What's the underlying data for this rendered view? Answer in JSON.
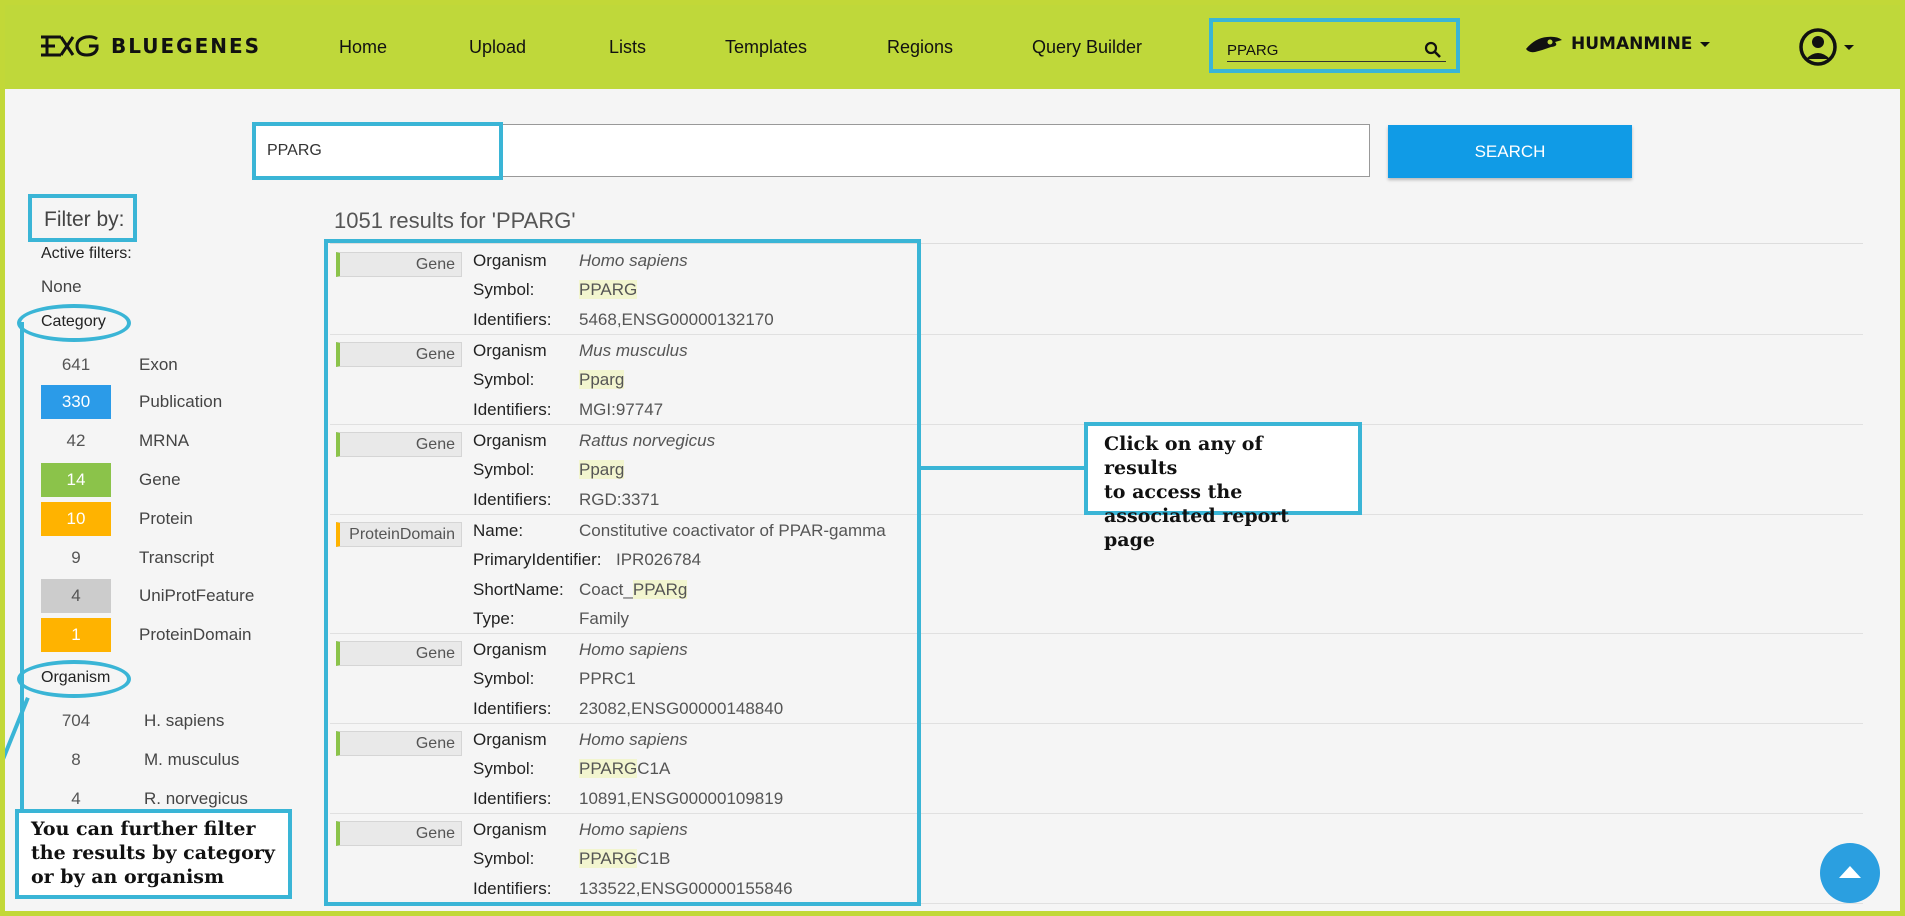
{
  "header": {
    "brand": "BLUEGENES",
    "nav": [
      "Home",
      "Upload",
      "Lists",
      "Templates",
      "Regions",
      "Query Builder"
    ],
    "search_value": "PPARG",
    "mine_name": "HUMANMINE"
  },
  "search": {
    "value": "PPARG",
    "button_label": "SEARCH"
  },
  "filters": {
    "title": "Filter by:",
    "active_label": "Active filters:",
    "active_value": "None",
    "category_label": "Category",
    "categories": [
      {
        "count": "641",
        "label": "Exon",
        "color": ""
      },
      {
        "count": "330",
        "label": "Publication",
        "color": "#2b9be8"
      },
      {
        "count": "42",
        "label": "MRNA",
        "color": ""
      },
      {
        "count": "14",
        "label": "Gene",
        "color": "#8bc34a"
      },
      {
        "count": "10",
        "label": "Protein",
        "color": "#ffb300"
      },
      {
        "count": "9",
        "label": "Transcript",
        "color": ""
      },
      {
        "count": "4",
        "label": "UniProtFeature",
        "color": "#cccccc"
      },
      {
        "count": "1",
        "label": "ProteinDomain",
        "color": "#ffb300"
      }
    ],
    "organism_label": "Organism",
    "organisms": [
      {
        "count": "704",
        "label": "H. sapiens"
      },
      {
        "count": "8",
        "label": "M. musculus"
      },
      {
        "count": "4",
        "label": "R. norvegicus"
      }
    ]
  },
  "results": {
    "summary": "1051 results for 'PPARG'",
    "items": [
      {
        "type": "Gene",
        "rows": [
          {
            "field": "Organism",
            "value": "Homo sapiens",
            "italic": true
          },
          {
            "field": "Symbol:",
            "value_hl": "PPARG",
            "value_rest": ""
          },
          {
            "field": "Identifiers:",
            "value": "5468,ENSG00000132170"
          }
        ]
      },
      {
        "type": "Gene",
        "rows": [
          {
            "field": "Organism",
            "value": "Mus musculus",
            "italic": true
          },
          {
            "field": "Symbol:",
            "value_hl": "Pparg",
            "value_rest": ""
          },
          {
            "field": "Identifiers:",
            "value": "MGI:97747"
          }
        ]
      },
      {
        "type": "Gene",
        "rows": [
          {
            "field": "Organism",
            "value": "Rattus norvegicus",
            "italic": true
          },
          {
            "field": "Symbol:",
            "value_hl": "Pparg",
            "value_rest": ""
          },
          {
            "field": "Identifiers:",
            "value": "RGD:3371"
          }
        ]
      },
      {
        "type": "ProteinDomain",
        "rows": [
          {
            "field": "Name:",
            "value": "Constitutive coactivator of PPAR-gamma"
          },
          {
            "field": "PrimaryIdentifier:",
            "value": "IPR026784"
          },
          {
            "field": "ShortName:",
            "value_pre": "Coact_",
            "value_hl": "PPARg"
          },
          {
            "field": "Type:",
            "value": "Family"
          }
        ]
      },
      {
        "type": "Gene",
        "rows": [
          {
            "field": "Organism",
            "value": "Homo sapiens",
            "italic": true
          },
          {
            "field": "Symbol:",
            "value": "PPRC1"
          },
          {
            "field": "Identifiers:",
            "value": "23082,ENSG00000148840"
          }
        ]
      },
      {
        "type": "Gene",
        "rows": [
          {
            "field": "Organism",
            "value": "Homo sapiens",
            "italic": true
          },
          {
            "field": "Symbol:",
            "value_hl": "PPARG",
            "value_rest": "C1A"
          },
          {
            "field": "Identifiers:",
            "value": "10891,ENSG00000109819"
          }
        ]
      },
      {
        "type": "Gene",
        "rows": [
          {
            "field": "Organism",
            "value": "Homo sapiens",
            "italic": true
          },
          {
            "field": "Symbol:",
            "value_hl": "PPARG",
            "value_rest": "C1B"
          },
          {
            "field": "Identifiers:",
            "value": "133522,ENSG00000155846"
          }
        ]
      }
    ]
  },
  "annotations": {
    "click_note": [
      "Click on any of results",
      "to access the",
      "associated report page"
    ],
    "filter_note": [
      "You can further filter",
      "the results by category",
      "or by an organism"
    ]
  },
  "colors": {
    "navbar": "#bfd83a",
    "accent": "#3ab5d6",
    "search_button": "#109be6"
  }
}
